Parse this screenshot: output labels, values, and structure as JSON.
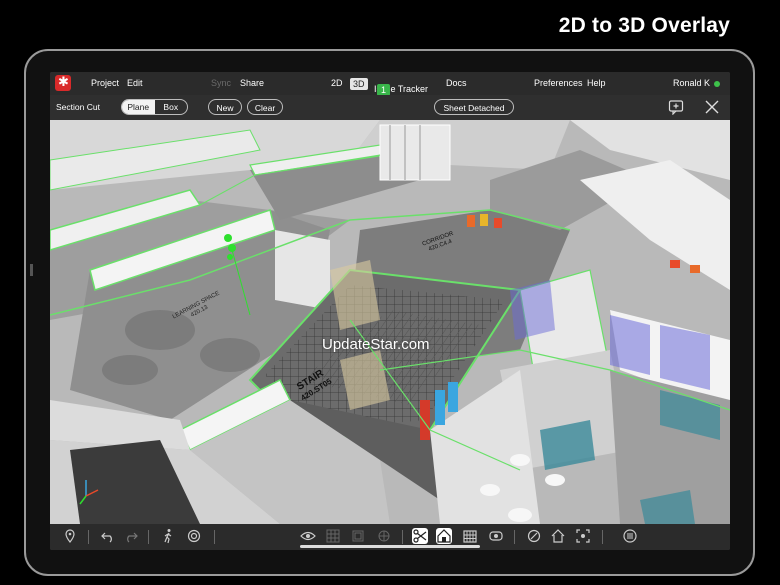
{
  "caption": "2D to 3D Overlay",
  "menubar": {
    "project": "Project",
    "edit": "Edit",
    "sync": "Sync",
    "share": "Share",
    "view_2d": "2D",
    "view_3d": "3D",
    "issue_tracker": "Issue Tracker",
    "issue_count": "1",
    "docs": "Docs",
    "preferences": "Preferences",
    "help": "Help",
    "user": "Ronald K"
  },
  "toolbar": {
    "section_cut": "Section Cut",
    "plane": "Plane",
    "box": "Box",
    "new": "New",
    "clear": "Clear",
    "sheet_detached": "Sheet Detached"
  },
  "model": {
    "watermark": "UpdateStar.com",
    "labels": {
      "learning_space": "LEARNING SPACE",
      "learning_space_num": "420.13",
      "corridor": "CORRIDOR",
      "corridor_num": "420.C4.4",
      "stair": "STAIR",
      "stair_num": "420.ST05"
    }
  },
  "colors": {
    "accent_green": "#39b54a",
    "outline_green": "#6ae06a",
    "brand_red": "#d92a2a",
    "status_online": "#3ec24b"
  },
  "icons": [
    "location-pin-icon",
    "undo-icon",
    "redo-icon",
    "walk-icon",
    "settings-target-icon",
    "eye-icon",
    "grid-icon",
    "layers-icon",
    "section-cut-icon",
    "home-box-icon",
    "building-icon",
    "visibility-icon",
    "section-icon",
    "home-icon",
    "fit-icon",
    "list-icon"
  ]
}
